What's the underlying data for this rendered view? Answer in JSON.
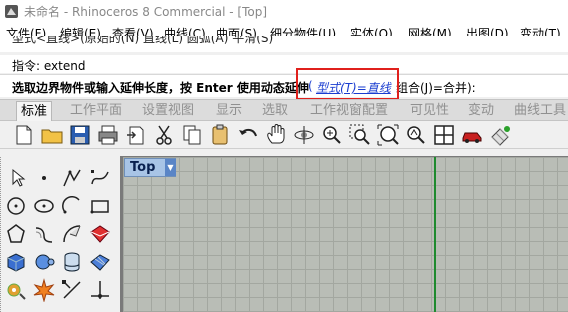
{
  "window": {
    "title": "未命名 - Rhinoceros 8 Commercial - [Top]",
    "icon": "rhino-app-icon"
  },
  "menu": {
    "items": [
      "文件(F)",
      "编辑(E)",
      "查看(V)",
      "曲线(C)",
      "曲面(S)",
      "细分物件(U)",
      "实体(O)",
      "网格(M)",
      "出图(D)",
      "变动(T)"
    ]
  },
  "command": {
    "history_line": "型式<直线>(原始的(N) 直线(L) 圆弧(A) 平滑(S)",
    "prompt_label": "指令: extend",
    "current_lead": "选取边界物件或输入延伸长度，按 Enter 使用动态延伸",
    "open_paren": "(",
    "option_type": "型式(T)=直线",
    "rest": "组合(J)=合并):"
  },
  "tabs": [
    "标准",
    "工作平面",
    "设置视图",
    "显示",
    "选取",
    "工作视窗配置",
    "可见性",
    "变动",
    "曲线工具"
  ],
  "active_tab": "标准",
  "toolbar": {
    "icons": [
      "new-document-icon",
      "open-folder-icon",
      "save-icon",
      "print-icon",
      "import-icon",
      "cut-icon",
      "copy-icon",
      "paste-icon",
      "undo-icon",
      "pan-hand-icon",
      "rotate-view-icon",
      "zoom-dynamic-icon",
      "zoom-window-icon",
      "zoom-extents-icon",
      "zoom-selected-icon",
      "four-viewports-icon",
      "car-render-icon",
      "grid-tools-icon"
    ]
  },
  "left_tools": {
    "icons": [
      "select-arrow-icon",
      "point-icon",
      "polyline-icon",
      "curve-icon",
      "circle-icon",
      "ellipse-icon",
      "arc-icon",
      "rectangle-icon",
      "polygon-icon",
      "curve-offset-icon",
      "freeform-curve-icon",
      "surface-icon",
      "box-icon",
      "sphere-icon",
      "cylinder-icon",
      "subd-icon",
      "gear-tools-icon",
      "explode-icon",
      "trim-icon",
      "split-icon"
    ]
  },
  "viewport": {
    "name": "Top",
    "dropdown_glyph": "▼"
  },
  "colors": {
    "highlight": "#e0201c",
    "link": "#1a3dd0",
    "viewport_bg": "#b9bdb6",
    "y_axis": "#1e8a2e"
  }
}
